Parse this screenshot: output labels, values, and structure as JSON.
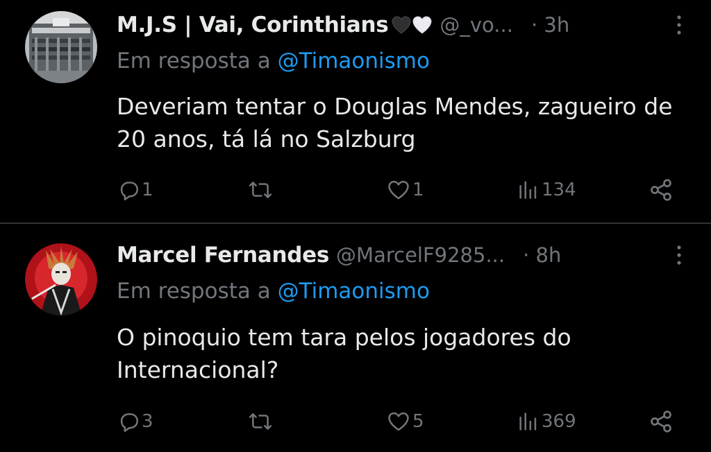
{
  "tweets": [
    {
      "display_name": "M.J.S | Vai, Corinthians",
      "emoji_icons": [
        "black-heart-icon",
        "white-heart-icon"
      ],
      "handle": "@_vo...",
      "time": "· 3h",
      "reply_prefix": "Em resposta a",
      "reply_mention": "@Timaonismo",
      "text": "Deveriam tentar o Douglas Mendes, zagueiro de 20 anos, tá lá no Salzburg",
      "replies": "1",
      "retweets": "",
      "likes": "1",
      "views": "134"
    },
    {
      "display_name": "Marcel Fernandes",
      "handle": "@MarcelF9285...",
      "time": "· 8h",
      "reply_prefix": "Em resposta a",
      "reply_mention": "@Timaonismo",
      "text": "O pinoquio tem tara pelos jogadores do Internacional?",
      "replies": "3",
      "retweets": "",
      "likes": "5",
      "views": "369"
    }
  ],
  "colors": {
    "background": "#000000",
    "primary_text": "#e7e9ea",
    "secondary_text": "#71767b",
    "link": "#1d9bf0",
    "divider": "#2f3336"
  }
}
